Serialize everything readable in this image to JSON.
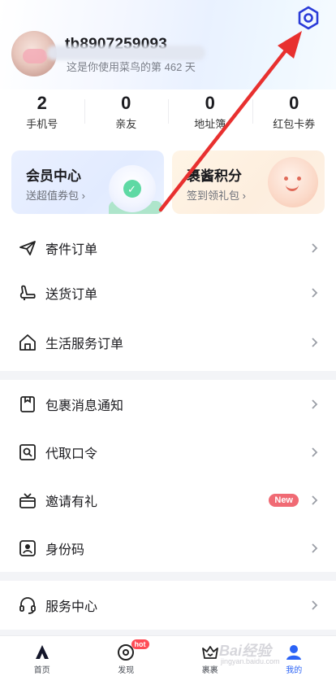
{
  "profile": {
    "username": "tb8907259093",
    "subline": "这是你使用菜鸟的第 462 天"
  },
  "stats": [
    {
      "value": "2",
      "label": "手机号"
    },
    {
      "value": "0",
      "label": "亲友"
    },
    {
      "value": "0",
      "label": "地址簿"
    },
    {
      "value": "0",
      "label": "红包卡券"
    }
  ],
  "cards": {
    "member": {
      "title": "会员中心",
      "subtitle": "送超值券包 ›"
    },
    "points": {
      "title": "裹酱积分",
      "subtitle": "签到领礼包 ›"
    }
  },
  "menu_orders": [
    {
      "label": "寄件订单",
      "icon": "paper-plane-icon"
    },
    {
      "label": "送货订单",
      "icon": "delivery-icon"
    },
    {
      "label": "生活服务订单",
      "icon": "home-icon"
    }
  ],
  "menu_tools": [
    {
      "label": "包裹消息通知",
      "icon": "package-note-icon"
    },
    {
      "label": "代取口令",
      "icon": "pickup-code-icon"
    },
    {
      "label": "邀请有礼",
      "icon": "gift-icon",
      "badge": "New"
    },
    {
      "label": "身份码",
      "icon": "id-code-icon"
    }
  ],
  "menu_service": [
    {
      "label": "服务中心",
      "icon": "headset-icon"
    }
  ],
  "tabs": [
    {
      "label": "首页",
      "icon": "home-tab-icon"
    },
    {
      "label": "发现",
      "icon": "discover-icon",
      "badge": "hot"
    },
    {
      "label": "裹裹",
      "icon": "crown-icon"
    },
    {
      "label": "我的",
      "icon": "profile-icon",
      "active": true
    }
  ],
  "watermark": {
    "text": "Bai经验",
    "sub": "jingyan.baidu.com"
  },
  "colors": {
    "accent": "#2b63f6",
    "annotation_arrow": "#e8302f",
    "badge_red": "#f06a74"
  }
}
